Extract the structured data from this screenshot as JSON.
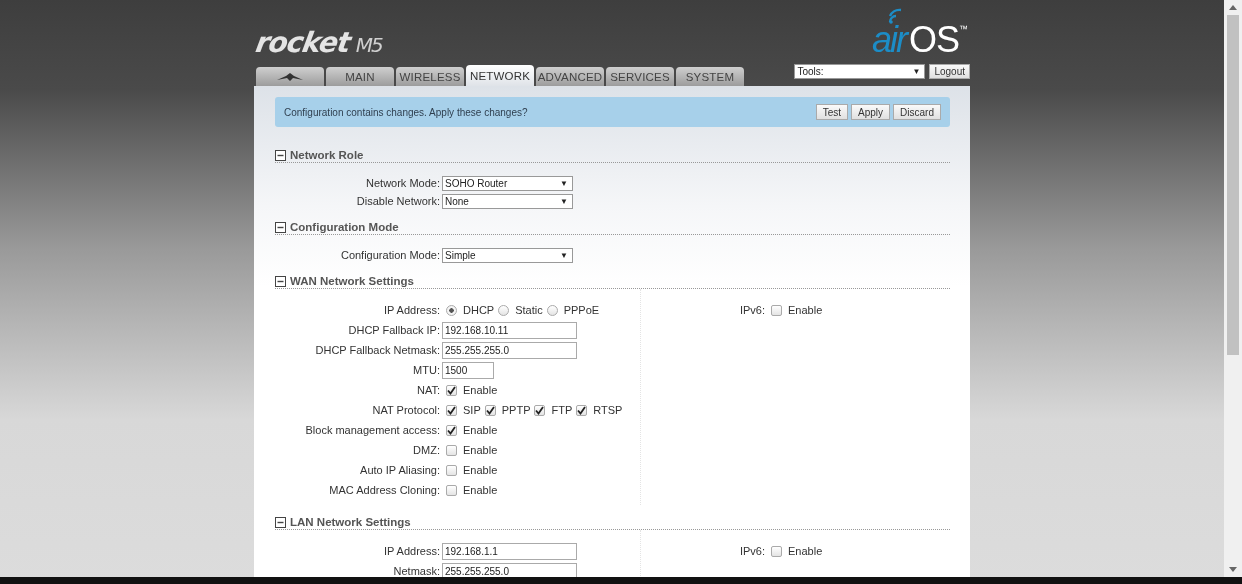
{
  "logo": {
    "product": "rocket",
    "model": "M5"
  },
  "brand": {
    "air": "air",
    "os": "OS",
    "mark": "™"
  },
  "tabs": [
    {
      "kind": "logo",
      "selected": false
    },
    {
      "kind": "text",
      "label": "MAIN",
      "selected": false
    },
    {
      "kind": "text",
      "label": "WIRELESS",
      "selected": false
    },
    {
      "kind": "text",
      "label": "NETWORK",
      "selected": true
    },
    {
      "kind": "text",
      "label": "ADVANCED",
      "selected": false
    },
    {
      "kind": "text",
      "label": "SERVICES",
      "selected": false
    },
    {
      "kind": "text",
      "label": "SYSTEM",
      "selected": false
    }
  ],
  "tools": {
    "value": "Tools:",
    "arrow": "▼"
  },
  "logout": "Logout",
  "alert": {
    "message": "Configuration contains changes. Apply these changes?",
    "buttons": [
      "Test",
      "Apply",
      "Discard"
    ]
  },
  "sections": [
    {
      "title": "Network Role",
      "expanded": true,
      "rows": [
        {
          "kind": "select",
          "label": "Network Mode:",
          "value": "SOHO Router",
          "arrow": "▼"
        },
        {
          "kind": "select",
          "label": "Disable Network:",
          "value": "None",
          "arrow": "▼"
        }
      ]
    },
    {
      "title": "Configuration Mode",
      "expanded": true,
      "rows": [
        {
          "kind": "select",
          "label": "Configuration Mode:",
          "value": "Simple",
          "arrow": "▼"
        }
      ]
    },
    {
      "title": "WAN Network Settings",
      "expanded": true,
      "rows": [
        {
          "kind": "radio",
          "label": "IP Address:",
          "options": [
            {
              "label": "DHCP",
              "selected": true
            },
            {
              "label": "Static",
              "selected": false
            },
            {
              "label": "PPPoE",
              "selected": false
            }
          ]
        },
        {
          "kind": "text",
          "label": "DHCP Fallback IP:",
          "value": "192.168.10.11"
        },
        {
          "kind": "text",
          "label": "DHCP Fallback Netmask:",
          "value": "255.255.255.0"
        },
        {
          "kind": "number",
          "label": "MTU:",
          "value": "1500"
        },
        {
          "kind": "checks",
          "label": "NAT:",
          "options": [
            {
              "label": "Enable",
              "checked": true
            }
          ]
        },
        {
          "kind": "checks",
          "label": "NAT Protocol:",
          "options": [
            {
              "label": "SIP",
              "checked": true
            },
            {
              "label": "PPTP",
              "checked": true
            },
            {
              "label": "FTP",
              "checked": true
            },
            {
              "label": "RTSP",
              "checked": true
            }
          ]
        },
        {
          "kind": "checks",
          "label": "Block management access:",
          "options": [
            {
              "label": "Enable",
              "checked": true
            }
          ]
        },
        {
          "kind": "checks",
          "label": "DMZ:",
          "options": [
            {
              "label": "Enable",
              "checked": false
            }
          ]
        },
        {
          "kind": "checks",
          "label": "Auto IP Aliasing:",
          "options": [
            {
              "label": "Enable",
              "checked": false
            }
          ]
        },
        {
          "kind": "checks",
          "label": "MAC Address Cloning:",
          "options": [
            {
              "label": "Enable",
              "checked": false
            }
          ]
        }
      ],
      "side_rows": [
        {
          "kind": "checks",
          "label": "IPv6:",
          "options": [
            {
              "label": "Enable",
              "checked": false
            }
          ]
        }
      ]
    },
    {
      "title": "LAN Network Settings",
      "expanded": true,
      "rows": [
        {
          "kind": "text",
          "label": "IP Address:",
          "value": "192.168.1.1"
        },
        {
          "kind": "text",
          "label": "Netmask:",
          "value": "255.255.255.0"
        }
      ],
      "side_rows": [
        {
          "kind": "checks",
          "label": "IPv6:",
          "options": [
            {
              "label": "Enable",
              "checked": false
            }
          ]
        }
      ]
    }
  ]
}
